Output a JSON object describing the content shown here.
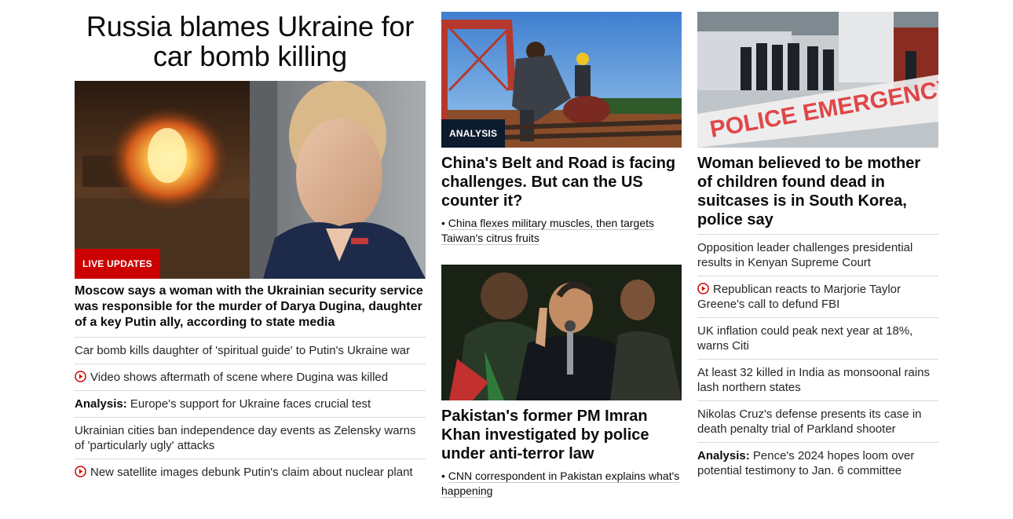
{
  "col1": {
    "headline": "Russia blames Ukraine for car bomb killing",
    "badge": "LIVE UPDATES",
    "lead": "Moscow says a woman with the Ukrainian security service was responsible for the murder of Darya Dugina, daughter of a key Putin ally, according to state media",
    "links": [
      {
        "prefix": "",
        "text": "Car bomb kills daughter of 'spiritual guide' to Putin's Ukraine war",
        "video": false
      },
      {
        "prefix": "",
        "text": "Video shows aftermath of scene where Dugina was killed",
        "video": true
      },
      {
        "prefix": "Analysis:",
        "text": "Europe's support for Ukraine faces crucial test",
        "video": false
      },
      {
        "prefix": "",
        "text": "Ukrainian cities ban independence day events as Zelensky warns of 'particularly ugly' attacks",
        "video": false
      },
      {
        "prefix": "",
        "text": "New satellite images debunk Putin's claim about nuclear plant",
        "video": true
      }
    ]
  },
  "col2": {
    "story1": {
      "badge": "ANALYSIS",
      "title": "China's Belt and Road is facing challenges. But can the US counter it?",
      "bullet": "China flexes military muscles, then targets Taiwan's citrus fruits"
    },
    "story2": {
      "title": "Pakistan's former PM Imran Khan investigated by police under anti-terror law",
      "bullet": "CNN correspondent in Pakistan explains what's happening"
    }
  },
  "col3": {
    "image_text": "POLICE EMERGENCY",
    "title": "Woman believed to be mother of children found dead in suitcases is in South Korea, police say",
    "links": [
      {
        "prefix": "",
        "text": "Opposition leader challenges presidential results in Kenyan Supreme Court",
        "video": false
      },
      {
        "prefix": "",
        "text": "Republican reacts to Marjorie Taylor Greene's call to defund FBI",
        "video": true
      },
      {
        "prefix": "",
        "text": "UK inflation could peak next year at 18%, warns Citi",
        "video": false
      },
      {
        "prefix": "",
        "text": "At least 32 killed in India as monsoonal rains lash northern states",
        "video": false
      },
      {
        "prefix": "",
        "text": "Nikolas Cruz's defense presents its case in death penalty trial of Parkland shooter",
        "video": false
      },
      {
        "prefix": "Analysis:",
        "text": "Pence's 2024 hopes loom over potential testimony to Jan. 6 committee",
        "video": false
      }
    ]
  },
  "colors": {
    "live": "#cc0000",
    "analysis": "#0c1b2e",
    "play": "#cc0000",
    "divider": "#d9d9d9"
  },
  "icons": {
    "video": "play-circle-icon"
  }
}
